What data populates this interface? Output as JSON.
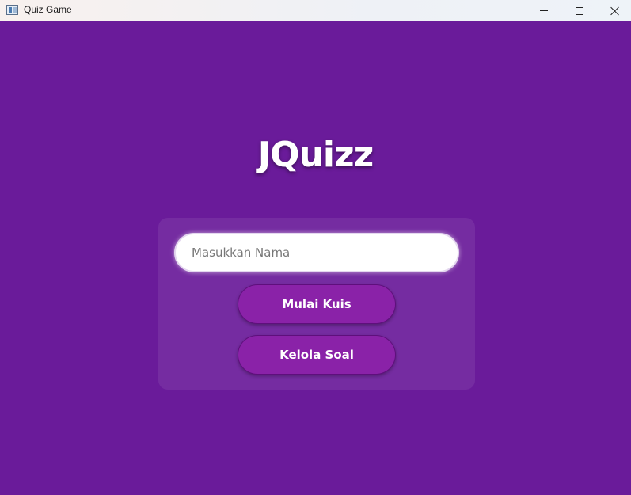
{
  "window": {
    "title": "Quiz Game",
    "controls": [
      "minimize",
      "maximize",
      "close"
    ]
  },
  "colors": {
    "background": "#6a1b9a",
    "button": "#8a22a8",
    "card": "rgba(255,255,255,0.08)",
    "text": "#ffffff"
  },
  "main": {
    "app_title": "JQuizz",
    "name_input": {
      "placeholder": "Masukkan Nama",
      "value": ""
    },
    "start_button": "Mulai Kuis",
    "manage_button": "Kelola Soal"
  }
}
